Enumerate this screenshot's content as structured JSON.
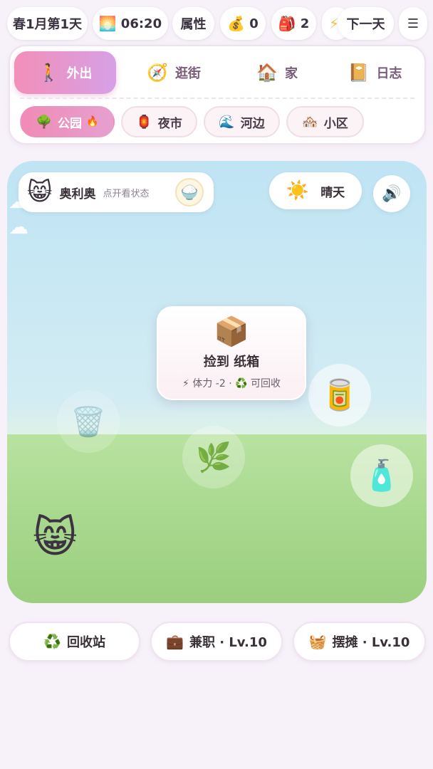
{
  "topbar": {
    "date": "春1月第1天",
    "time": "06:20",
    "time_icon": "🌅",
    "attributes": "属性",
    "money_icon": "💰",
    "money": "0",
    "bag_icon": "🎒",
    "bag_count": "2",
    "energy_icon": "⚡",
    "next_day": "下一天",
    "menu_icon": "☰"
  },
  "nav": {
    "tabs": [
      {
        "icon": "🚶",
        "label": "外出"
      },
      {
        "icon": "🧭",
        "label": "逛街"
      },
      {
        "icon": "🏠",
        "label": "家"
      },
      {
        "icon": "📔",
        "label": "日志"
      }
    ],
    "locations": [
      {
        "icon": "🌳",
        "label": "公园",
        "badge": "🔥"
      },
      {
        "icon": "🏮",
        "label": "夜市"
      },
      {
        "icon": "🌊",
        "label": "河边"
      },
      {
        "icon": "🏘️",
        "label": "小区"
      }
    ]
  },
  "scene": {
    "cat_icon": "😸",
    "cat_name": "奥利奥",
    "cat_hint": "点开看状态",
    "bowl_icon": "🍚",
    "weather_icon": "☀️",
    "weather": "晴天",
    "sound_icon": "🔊",
    "cloud_icon": "☁",
    "items": {
      "trash": "🗑️",
      "leaf": "🌿",
      "can": "🥫",
      "bottle": "🧴"
    },
    "popup": {
      "icon": "📦",
      "action": "捡到",
      "item": "纸箱",
      "energy_icon": "⚡",
      "cost": "体力 -2",
      "sep": "·",
      "recycle_icon": "♻️",
      "recyclable": "可回收"
    },
    "big_cat_icon": "😸"
  },
  "bottom": [
    {
      "icon": "♻️",
      "label": "回收站"
    },
    {
      "icon": "💼",
      "label": "兼职 · Lv.10"
    },
    {
      "icon": "🧺",
      "label": "摆摊 · Lv.10"
    }
  ]
}
